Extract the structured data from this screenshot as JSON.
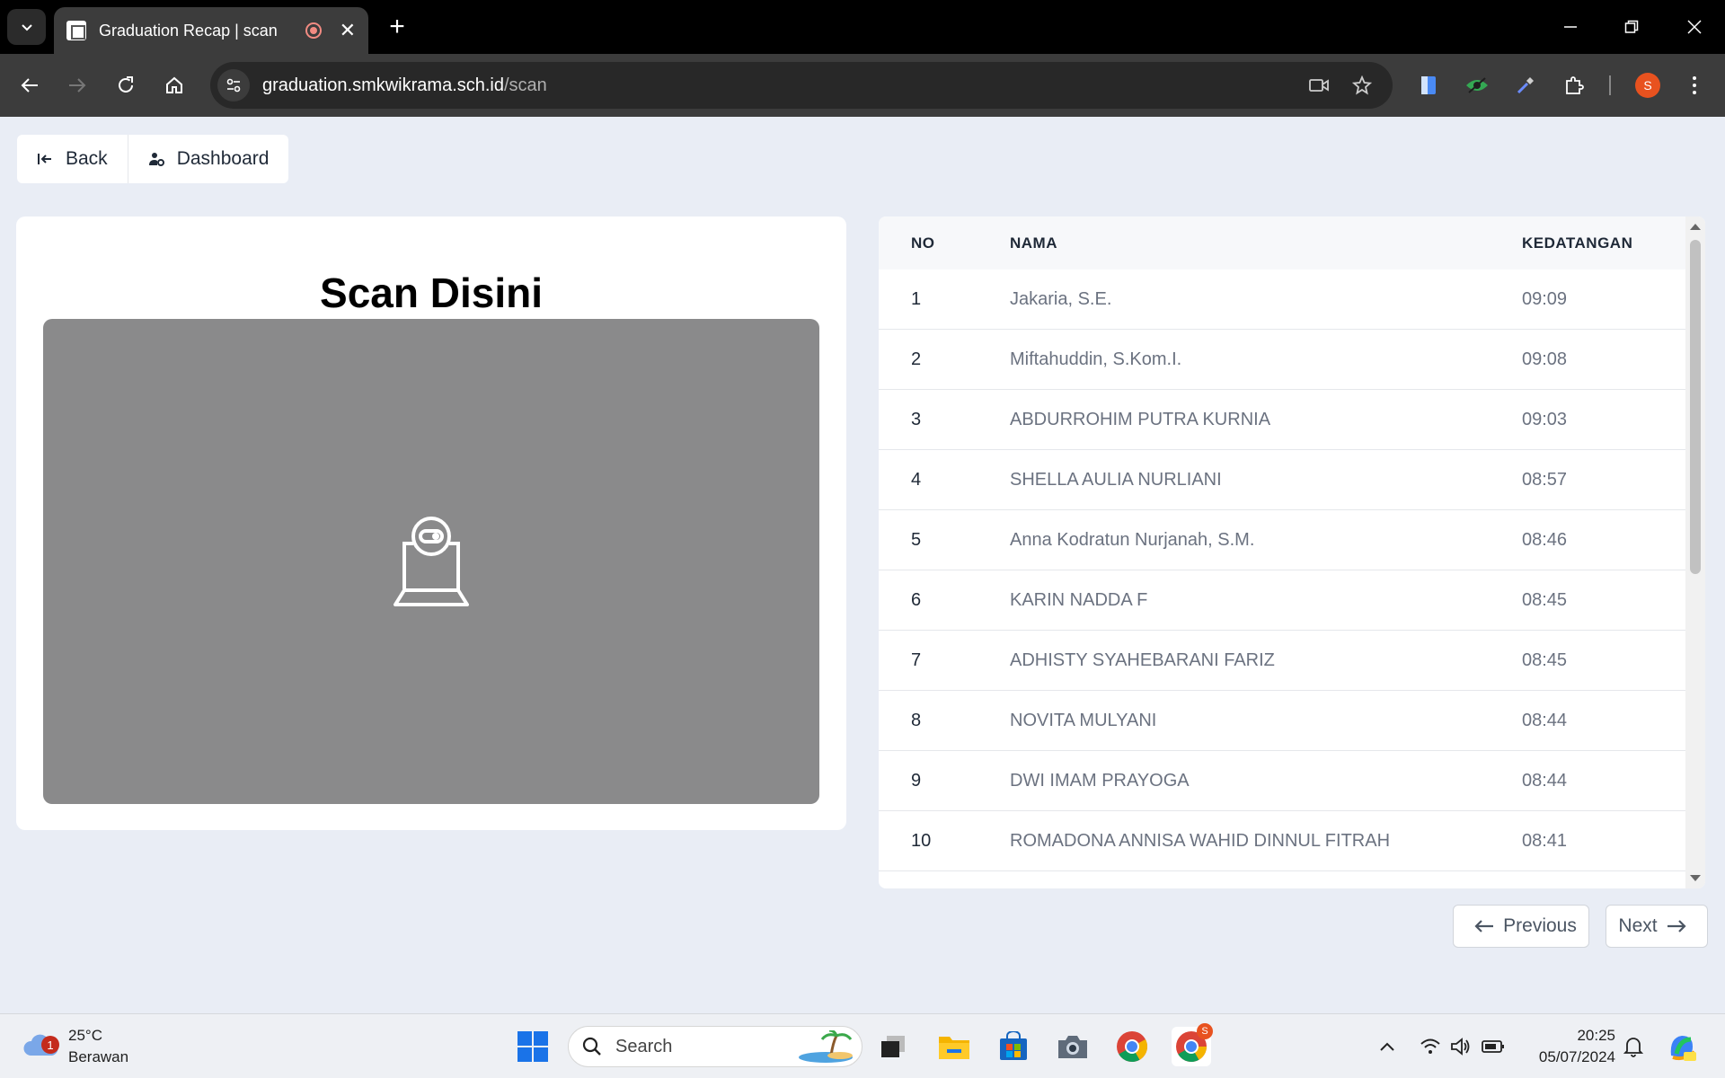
{
  "browser": {
    "tab_title": "Graduation Recap | scan",
    "url_host": "graduation.smkwikrama.sch.id",
    "url_path": "/scan",
    "profile_initial": "S",
    "new_tab_label": "+",
    "close_label": "✕"
  },
  "actions": {
    "back_label": "Back",
    "dashboard_label": "Dashboard"
  },
  "scan": {
    "title": "Scan Disini"
  },
  "table": {
    "headers": {
      "no": "NO",
      "nama": "NAMA",
      "kedatangan": "KEDATANGAN"
    },
    "rows": [
      {
        "no": "1",
        "nama": "Jakaria, S.E.",
        "time": "09:09"
      },
      {
        "no": "2",
        "nama": "Miftahuddin, S.Kom.I.",
        "time": "09:08"
      },
      {
        "no": "3",
        "nama": "ABDURROHIM PUTRA KURNIA",
        "time": "09:03"
      },
      {
        "no": "4",
        "nama": "SHELLA AULIA NURLIANI",
        "time": "08:57"
      },
      {
        "no": "5",
        "nama": "Anna Kodratun Nurjanah, S.M.",
        "time": "08:46"
      },
      {
        "no": "6",
        "nama": "KARIN NADDA F",
        "time": "08:45"
      },
      {
        "no": "7",
        "nama": "ADHISTY SYAHEBARANI FARIZ",
        "time": "08:45"
      },
      {
        "no": "8",
        "nama": "NOVITA MULYANI",
        "time": "08:44"
      },
      {
        "no": "9",
        "nama": "DWI IMAM PRAYOGA",
        "time": "08:44"
      },
      {
        "no": "10",
        "nama": "ROMADONA ANNISA WAHID DINNUL FITRAH",
        "time": "08:41"
      }
    ]
  },
  "pagination": {
    "previous_label": "Previous",
    "next_label": "Next"
  },
  "taskbar": {
    "weather_temp": "25°C",
    "weather_desc": "Berawan",
    "weather_badge": "1",
    "search_label": "Search",
    "time": "20:25",
    "date": "05/07/2024",
    "chrome_badge": "S"
  },
  "colors": {
    "page_bg": "#e9edf5",
    "scan_area": "#8a8a8b",
    "profile": "#e8521f"
  }
}
